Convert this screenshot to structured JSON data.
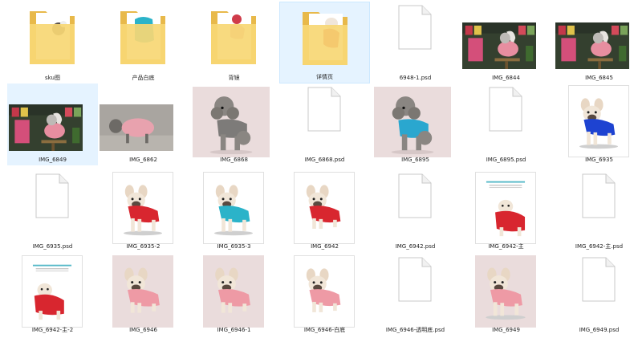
{
  "files": [
    {
      "name": "sku图",
      "type": "folder",
      "paper": "dog-white"
    },
    {
      "name": "产品白底",
      "type": "folder",
      "paper": "vest-blue"
    },
    {
      "name": "背镜",
      "type": "folder",
      "paper": "dog-pink"
    },
    {
      "name": "详情页",
      "type": "folder-selected",
      "paper": "dog-red"
    },
    {
      "name": "6948-1.psd",
      "type": "psd"
    },
    {
      "name": "IMG_6844",
      "type": "photo",
      "scene": "room-cat"
    },
    {
      "name": "IMG_6845",
      "type": "photo",
      "scene": "room-cat"
    },
    {
      "name": "IMG_6849",
      "type": "photo",
      "scene": "room-cat",
      "selected": true
    },
    {
      "name": "IMG_6862",
      "type": "photo",
      "scene": "cat-pink"
    },
    {
      "name": "IMG_6868",
      "type": "photo",
      "scene": "poodle-pink"
    },
    {
      "name": "IMG_6868.psd",
      "type": "psd"
    },
    {
      "name": "IMG_6895",
      "type": "photo",
      "scene": "poodle-blue"
    },
    {
      "name": "IMG_6895.psd",
      "type": "psd"
    },
    {
      "name": "IMG_6935",
      "type": "photo",
      "scene": "bulldog-blue"
    },
    {
      "name": "IMG_6935.psd",
      "type": "psd"
    },
    {
      "name": "IMG_6935-2",
      "type": "photo",
      "scene": "bulldog-red"
    },
    {
      "name": "IMG_6935-3",
      "type": "photo",
      "scene": "bulldog-teal"
    },
    {
      "name": "IMG_6942",
      "type": "photo",
      "scene": "bulldog-red-sit"
    },
    {
      "name": "IMG_6942.psd",
      "type": "psd"
    },
    {
      "name": "IMG_6942-主",
      "type": "photo",
      "scene": "poster-red"
    },
    {
      "name": "IMG_6942-主.psd",
      "type": "psd"
    },
    {
      "name": "IMG_6942-主-2",
      "type": "photo",
      "scene": "poster-red2"
    },
    {
      "name": "IMG_6946",
      "type": "photo",
      "scene": "bulldog-pink"
    },
    {
      "name": "IMG_6946-1",
      "type": "photo",
      "scene": "bulldog-pink"
    },
    {
      "name": "IMG_6946-白底",
      "type": "photo",
      "scene": "bulldog-pink-white"
    },
    {
      "name": "IMG_6946-透明底.psd",
      "type": "psd"
    },
    {
      "name": "IMG_6949",
      "type": "photo",
      "scene": "bulldog-pink-lie"
    },
    {
      "name": "IMG_6949.psd",
      "type": "psd"
    }
  ],
  "poster": {
    "title": "香港设计师作品"
  },
  "colors": {
    "folder": "#f7d774",
    "folder_dark": "#e8b94a",
    "selection": "#e5f3ff",
    "red": "#d8262f",
    "blue": "#1e43d1",
    "teal": "#2bb3c9",
    "pink": "#ee9aa5"
  }
}
